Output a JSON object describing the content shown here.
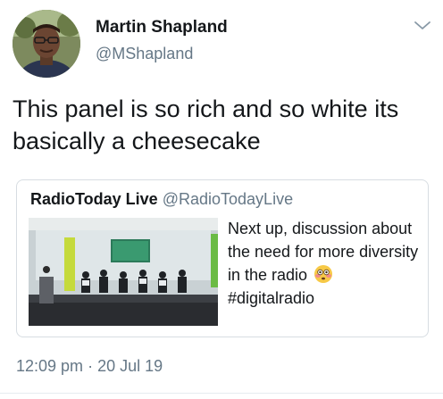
{
  "author": {
    "display_name": "Martin Shapland",
    "handle": "@MShapland",
    "avatar_icon": "person-avatar"
  },
  "tweet": {
    "text": "This panel is so rich and so white its basically a cheesecake"
  },
  "menu": {
    "icon": "chevron-down-icon"
  },
  "quoted_tweet": {
    "display_name": "RadioToday Live",
    "handle": "@RadioTodayLive",
    "text_before_emoji": "Next up, discussion about the need for more diversity in the radio",
    "emoji": "flushed-face",
    "hashtag": "#digitalradio",
    "image_icon": "panel-discussion-photo"
  },
  "meta": {
    "time": "12:09 pm",
    "separator": "·",
    "date": "20 Jul 19"
  },
  "colors": {
    "text_primary": "#14171a",
    "text_secondary": "#657786",
    "border": "#d7dde2"
  }
}
